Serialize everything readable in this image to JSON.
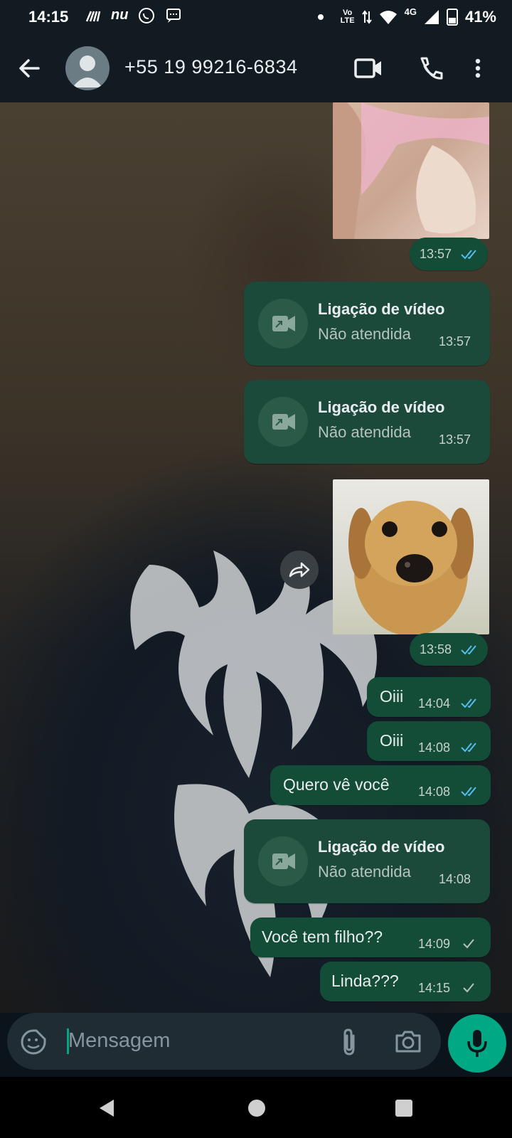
{
  "status_bar": {
    "time": "14:15",
    "left_icons": [
      "signal-bars-icon",
      "nubank-icon",
      "whatsapp-icon",
      "message-icon"
    ],
    "left_text_nu": "nu",
    "volte_top": "Vo",
    "volte_bottom": "LTE",
    "network": "4G",
    "battery": "41%"
  },
  "header": {
    "contact_name": "+55 19 99216-6834",
    "icons": [
      "back-arrow-icon",
      "video-call-icon",
      "phone-icon",
      "more-vert-icon"
    ]
  },
  "messages": [
    {
      "type": "image",
      "time": "13:57",
      "status": "read"
    },
    {
      "type": "call",
      "title": "Ligação de vídeo",
      "subtitle": "Não atendida",
      "time": "13:57"
    },
    {
      "type": "call",
      "title": "Ligação de vídeo",
      "subtitle": "Não atendida",
      "time": "13:57"
    },
    {
      "type": "image",
      "time": "13:58",
      "status": "read"
    },
    {
      "type": "text",
      "text": "Oiii",
      "time": "14:04",
      "status": "read"
    },
    {
      "type": "text",
      "text": "Oiii",
      "time": "14:08",
      "status": "read"
    },
    {
      "type": "text",
      "text": "Quero vê você",
      "time": "14:08",
      "status": "read"
    },
    {
      "type": "call",
      "title": "Ligação de vídeo",
      "subtitle": "Não atendida",
      "time": "14:08"
    },
    {
      "type": "text",
      "text": "Você tem filho??",
      "time": "14:09",
      "status": "sent"
    },
    {
      "type": "text",
      "text": "Linda???",
      "time": "14:15",
      "status": "sent"
    }
  ],
  "composer": {
    "placeholder": "Mensagem",
    "icons": [
      "emoji-sticker-icon",
      "attach-icon",
      "camera-icon",
      "mic-icon"
    ]
  },
  "colors": {
    "bubble": "#134d37",
    "accent": "#00a884",
    "read_tick": "#53bdeb",
    "header": "#121b22"
  }
}
